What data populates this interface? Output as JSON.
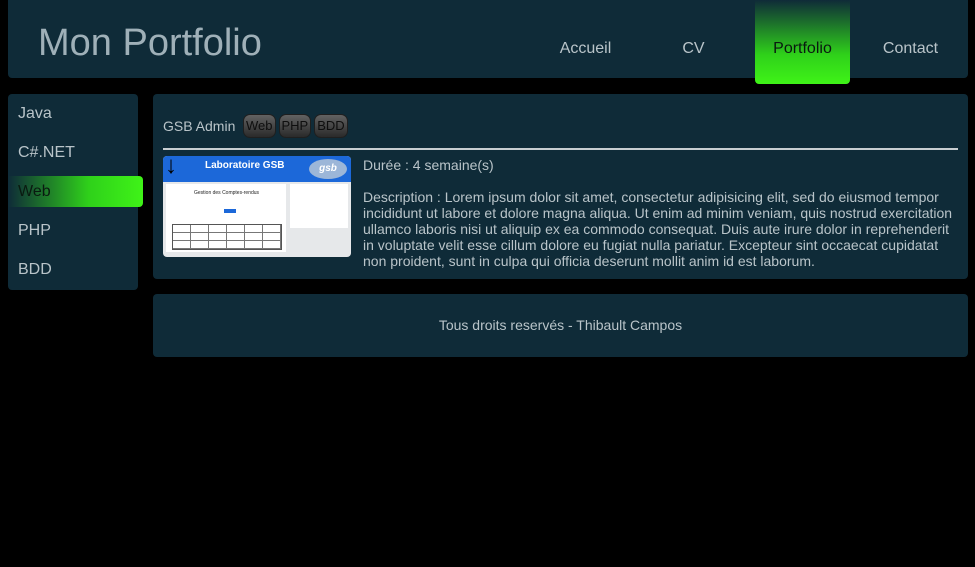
{
  "header": {
    "title": "Mon Portfolio",
    "nav": [
      "Accueil",
      "CV",
      "Portfolio",
      "Contact"
    ],
    "active_nav": "Portfolio"
  },
  "sidebar": {
    "items": [
      "Java",
      "C#.NET",
      "Web",
      "PHP",
      "BDD"
    ],
    "active_item": "Web"
  },
  "project": {
    "title": "GSB Admin",
    "tags": [
      "Web",
      "PHP",
      "BDD"
    ],
    "duration": "Durée : 4 semaine(s)",
    "description": "Description : Lorem ipsum dolor sit amet, consectetur adipisicing elit, sed do eiusmod tempor incididunt ut labore et dolore magna aliqua. Ut enim ad minim veniam, quis nostrud exercitation ullamco laboris nisi ut aliquip ex ea commodo consequat. Duis aute irure dolor in reprehenderit in voluptate velit esse cillum dolore eu fugiat nulla pariatur. Excepteur sint occaecat cupidatat non proident, sunt in culpa qui officia deserunt mollit anim id est laborum.",
    "thumbnail": {
      "banner": "Laboratoire GSB",
      "logo": "gsb",
      "heading": "Gestion des Comptes-rendus"
    }
  },
  "footer": {
    "text": "Tous droits reservés - Thibault Campos"
  },
  "colors": {
    "panel": "#0f2b38",
    "accent": "#3ff318",
    "text": "#b9c4c9",
    "background": "#000000"
  }
}
